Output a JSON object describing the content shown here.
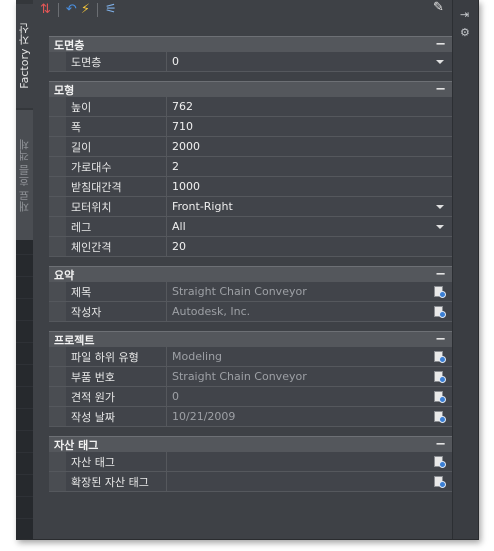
{
  "palette": {
    "tabs": {
      "factory_assets": "Factory 자산",
      "flow_objects": "재료 흐름 객체"
    }
  },
  "toolbar": {
    "icons": [
      "sort-icon",
      "undo-icon",
      "quick-select-icon",
      "filter-icon",
      "edit-icon"
    ]
  },
  "sections": [
    {
      "title": "도면층",
      "rows": [
        {
          "name": "도면층",
          "value": "0",
          "dropdown": true
        }
      ]
    },
    {
      "title": "모형",
      "rows": [
        {
          "name": "높이",
          "value": "762"
        },
        {
          "name": "폭",
          "value": "710"
        },
        {
          "name": "길이",
          "value": "2000"
        },
        {
          "name": "가로대수",
          "value": "2"
        },
        {
          "name": "받침대간격",
          "value": "1000"
        },
        {
          "name": "모터위치",
          "value": "Front-Right",
          "dropdown": true
        },
        {
          "name": "레그",
          "value": "All",
          "dropdown": true
        },
        {
          "name": "체인간격",
          "value": "20"
        }
      ]
    },
    {
      "title": "요약",
      "rows": [
        {
          "name": "제목",
          "value": "Straight Chain Conveyor",
          "picker": true,
          "readonly": true
        },
        {
          "name": "작성자",
          "value": "Autodesk, Inc.",
          "picker": true,
          "readonly": true
        }
      ]
    },
    {
      "title": "프로젝트",
      "rows": [
        {
          "name": "파일 하위 유형",
          "value": "Modeling",
          "picker": true,
          "readonly": true
        },
        {
          "name": "부품 번호",
          "value": "Straight Chain Conveyor",
          "picker": true,
          "readonly": true
        },
        {
          "name": "견적 원가",
          "value": "0",
          "picker": true,
          "readonly": true
        },
        {
          "name": "작성 날짜",
          "value": "10/21/2009",
          "picker": true,
          "readonly": true
        }
      ]
    },
    {
      "title": "자산 태그",
      "rows": [
        {
          "name": "자산 태그",
          "value": "",
          "picker": true
        },
        {
          "name": "확장된 자산 태그",
          "value": "",
          "picker": true
        }
      ]
    }
  ]
}
